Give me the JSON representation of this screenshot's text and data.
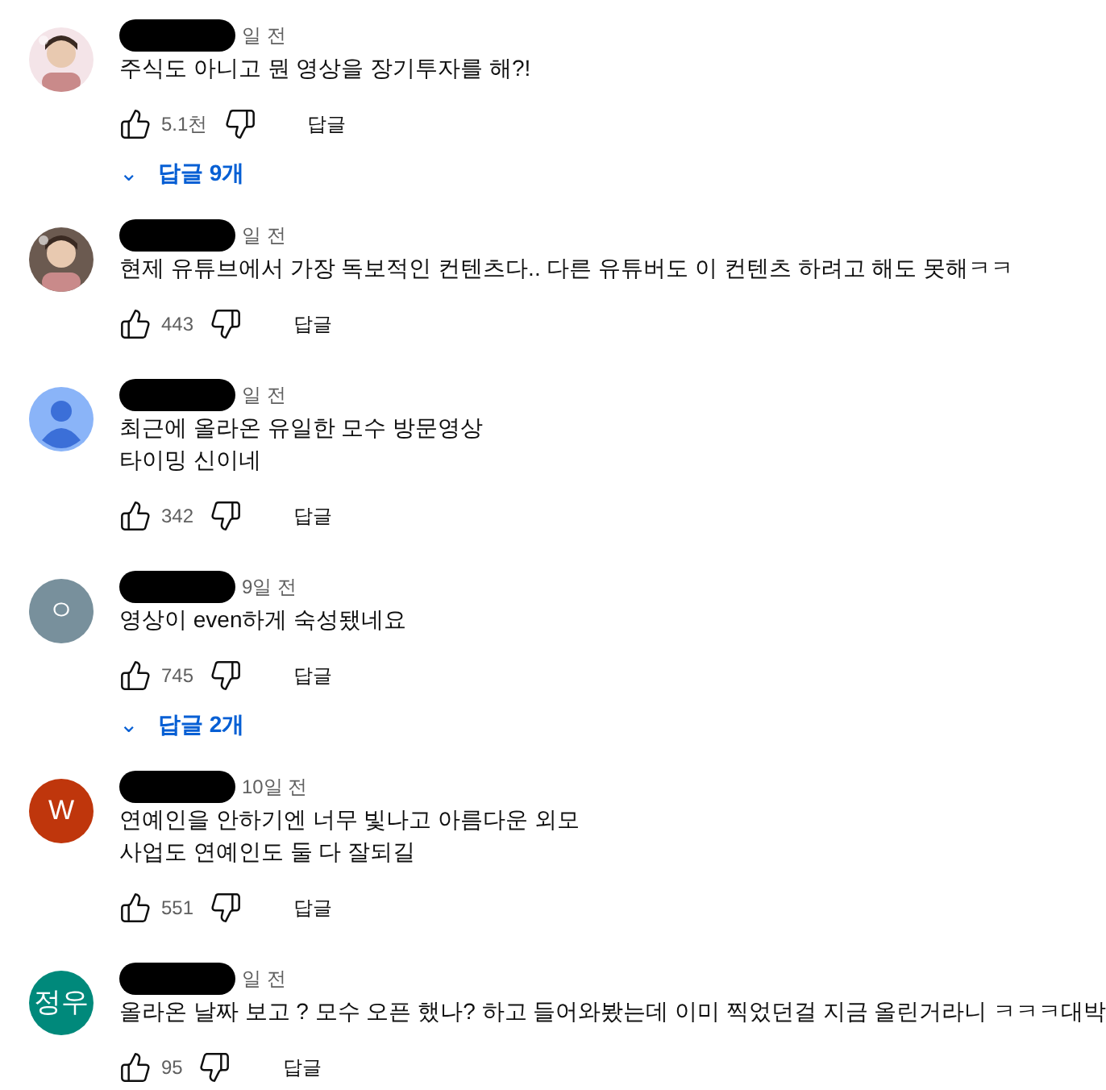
{
  "comments": [
    {
      "avatar": {
        "kind": "picture",
        "color": "#f4e4e8"
      },
      "time": "일 전",
      "text": [
        "주식도 아니고 뭔 영상을 장기투자를 해?!"
      ],
      "likes": "5.1천",
      "reply_button": "답글",
      "replies": {
        "chevron": "⌄",
        "label": "답글 9개"
      }
    },
    {
      "avatar": {
        "kind": "picture",
        "color": "#6b5a50"
      },
      "time": "일 전",
      "text": [
        "현제 유튜브에서 가장 독보적인 컨텐츠다.. 다른 유튜버도 이 컨텐츠 하려고 해도 못해ㅋㅋ"
      ],
      "likes": "443",
      "reply_button": "답글"
    },
    {
      "avatar": {
        "kind": "person",
        "color": "#8ab4f8"
      },
      "time": "일 전",
      "text": [
        "최근에 올라온 유일한 모수 방문영상",
        "타이밍 신이네"
      ],
      "likes": "342",
      "reply_button": "답글"
    },
    {
      "avatar": {
        "kind": "letter",
        "letter": "ㅇ",
        "color": "#78909c"
      },
      "time": "9일 전",
      "text": [
        "영상이 even하게 숙성됐네요"
      ],
      "likes": "745",
      "reply_button": "답글",
      "replies": {
        "chevron": "⌄",
        "label": "답글 2개"
      }
    },
    {
      "avatar": {
        "kind": "letter",
        "letter": "W",
        "color": "#bf360c"
      },
      "time": "10일 전",
      "text": [
        "연예인을 안하기엔 너무 빛나고 아름다운 외모",
        "사업도 연예인도 둘 다 잘되길"
      ],
      "likes": "551",
      "reply_button": "답글"
    },
    {
      "avatar": {
        "kind": "letter",
        "letter": "정우",
        "color": "#00897b"
      },
      "time": "일 전",
      "text": [
        "올라온 날짜 보고 ? 모수 오픈 했나? 하고 들어와봤는데 이미 찍었던걸 지금 올린거라니 ㅋㅋㅋ대박"
      ],
      "likes": "95",
      "reply_button": "답글"
    }
  ]
}
